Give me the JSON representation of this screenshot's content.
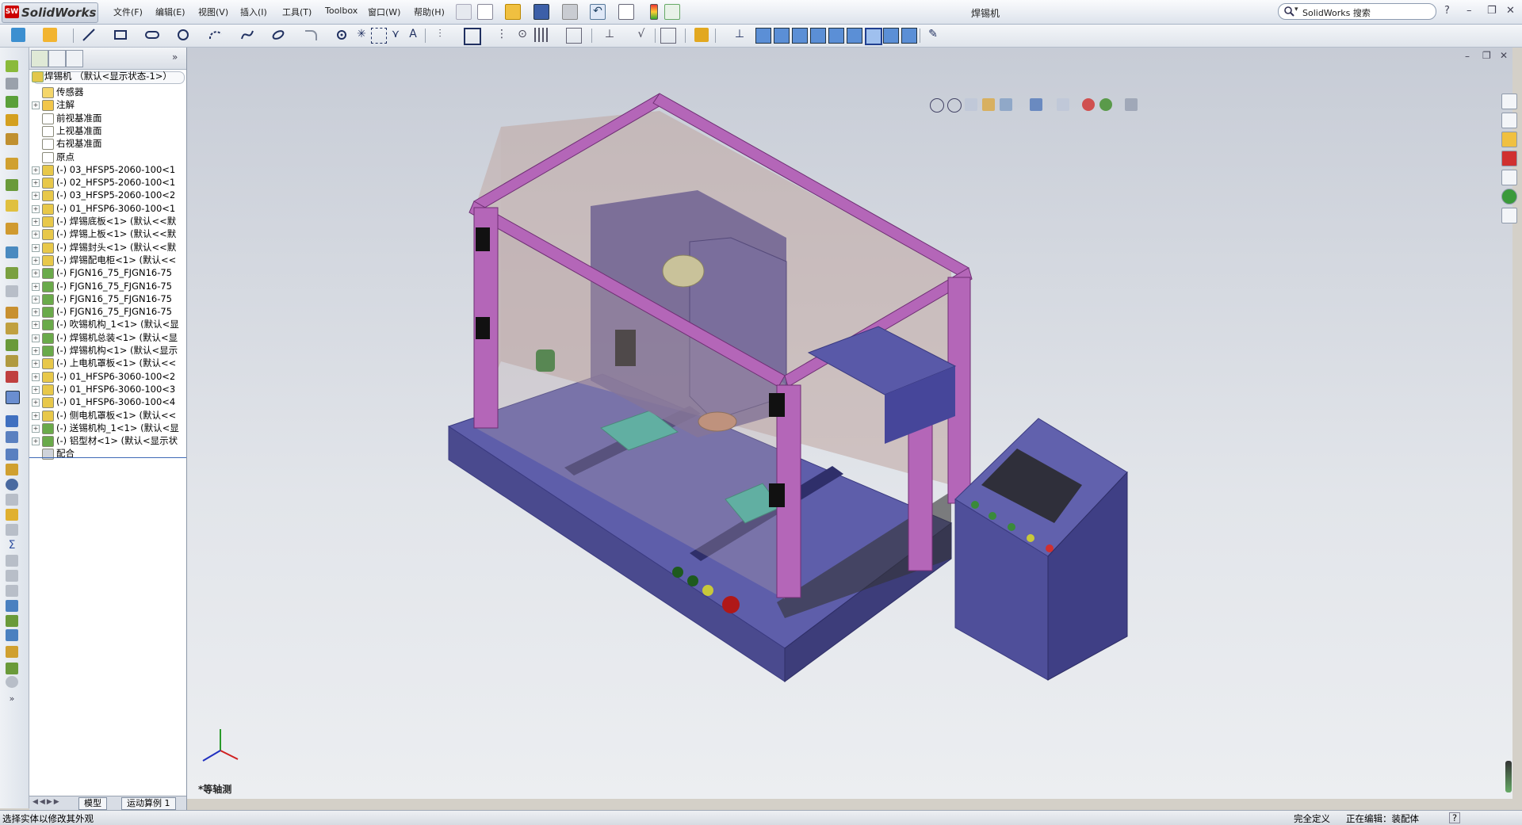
{
  "app": {
    "logo_text": "SolidWorks",
    "logo_badge": "SW",
    "document_title": "焊锡机"
  },
  "menu": [
    "文件(F)",
    "编辑(E)",
    "视图(V)",
    "插入(I)",
    "工具(T)",
    "Toolbox",
    "窗口(W)",
    "帮助(H)"
  ],
  "search": {
    "placeholder": "SolidWorks 搜索"
  },
  "window_controls": {
    "help": "?",
    "minimize": "–",
    "restore": "❐",
    "close": "✕"
  },
  "feature_tree": {
    "root": "焊锡机 （默认<显示状态-1>）",
    "items": [
      {
        "label": "传感器",
        "icon": "sensor-icon",
        "expand": false
      },
      {
        "label": "注解",
        "icon": "annotation-icon",
        "expand": true
      },
      {
        "label": "前视基准面",
        "icon": "plane-icon",
        "expand": false
      },
      {
        "label": "上视基准面",
        "icon": "plane-icon",
        "expand": false
      },
      {
        "label": "右视基准面",
        "icon": "plane-icon",
        "expand": false
      },
      {
        "label": "原点",
        "icon": "origin-icon",
        "expand": false
      },
      {
        "label": "(-) 03_HFSP5-2060-100<1",
        "icon": "part-icon",
        "expand": true
      },
      {
        "label": "(-) 02_HFSP5-2060-100<1",
        "icon": "part-icon",
        "expand": true
      },
      {
        "label": "(-) 03_HFSP5-2060-100<2",
        "icon": "part-icon",
        "expand": true
      },
      {
        "label": "(-) 01_HFSP6-3060-100<1",
        "icon": "part-icon",
        "expand": true
      },
      {
        "label": "(-) 焊锡底板<1> (默认<<默",
        "icon": "part-icon",
        "expand": true
      },
      {
        "label": "(-) 焊锡上板<1> (默认<<默",
        "icon": "part-icon",
        "expand": true
      },
      {
        "label": "(-) 焊锡封头<1> (默认<<默",
        "icon": "part-icon",
        "expand": true
      },
      {
        "label": "(-) 焊锡配电柜<1> (默认<<",
        "icon": "part-icon",
        "expand": true
      },
      {
        "label": "(-) FJGN16_75_FJGN16-75",
        "icon": "assembly-icon",
        "expand": true
      },
      {
        "label": "(-) FJGN16_75_FJGN16-75",
        "icon": "assembly-icon",
        "expand": true
      },
      {
        "label": "(-) FJGN16_75_FJGN16-75",
        "icon": "assembly-icon",
        "expand": true
      },
      {
        "label": "(-) FJGN16_75_FJGN16-75",
        "icon": "assembly-icon",
        "expand": true
      },
      {
        "label": "(-) 吹锡机构_1<1> (默认<显",
        "icon": "assembly-icon",
        "expand": true
      },
      {
        "label": "(-) 焊锡机总装<1> (默认<显",
        "icon": "assembly-icon",
        "expand": true
      },
      {
        "label": "(-) 焊锡机构<1> (默认<显示",
        "icon": "assembly-icon",
        "expand": true
      },
      {
        "label": "(-) 上电机罩板<1> (默认<<",
        "icon": "part-icon",
        "expand": true
      },
      {
        "label": "(-) 01_HFSP6-3060-100<2",
        "icon": "part-icon",
        "expand": true
      },
      {
        "label": "(-) 01_HFSP6-3060-100<3",
        "icon": "part-icon",
        "expand": true
      },
      {
        "label": "(-) 01_HFSP6-3060-100<4",
        "icon": "part-icon",
        "expand": true
      },
      {
        "label": "(-) 侧电机罩板<1> (默认<<",
        "icon": "part-icon",
        "expand": true
      },
      {
        "label": "(-) 送锡机构_1<1> (默认<显",
        "icon": "assembly-icon",
        "expand": true
      },
      {
        "label": "(-) 铝型材<1> (默认<显示状",
        "icon": "assembly-icon",
        "expand": true
      },
      {
        "label": "配合",
        "icon": "mates-icon",
        "expand": false
      }
    ]
  },
  "bottom_tabs": [
    "模型",
    "运动算例 1"
  ],
  "viewport": {
    "view_name": "*等轴测",
    "background": "#d7dae1"
  },
  "status": {
    "left": "选择实体以修改其外观",
    "defined": "完全定义",
    "editing": "正在编辑：装配体",
    "help": "?"
  },
  "colors": {
    "frame": "#a45aa7",
    "base": "#5a5a9e",
    "panel_glass": "#c2b0a8",
    "accent_green": "#3bb3a0"
  }
}
